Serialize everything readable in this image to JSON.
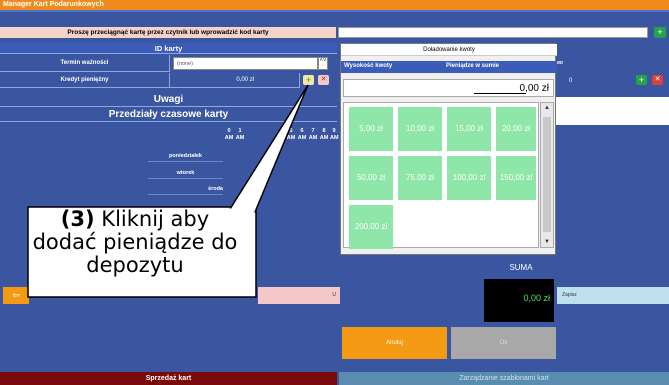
{
  "window": {
    "title": "Manager Kart Podarunkowych"
  },
  "prompt": {
    "text": "Proszę przeciągnąć kartę przez czytnik lub wprowadzić kod karty"
  },
  "card_form": {
    "id_header": "ID karty",
    "expiry_label": "Termin ważności",
    "expiry_value": "(none)",
    "credit_label": "Kredyt pieniężny",
    "credit_value": "0,00 zł",
    "right_value": "0",
    "right_hdr_partial": "wo"
  },
  "notes_header": "Uwagi",
  "time_ranges": {
    "header": "Przedziały czasowe karty",
    "hours": [
      "0",
      "1",
      "2",
      "",
      "5",
      "6",
      "7",
      "8",
      "9"
    ],
    "ampm": "AM",
    "days": [
      "poniedziałek",
      "wtorek",
      "środa"
    ]
  },
  "popup": {
    "title": "Doładowanie kwoty",
    "col_amount": "Wysokość kwoty",
    "col_money": "Pieniądze w sumie",
    "amount": "0,00 zł",
    "tiles": [
      "5,00 zł",
      "10,00 zł",
      "15,00 zł",
      "20,00 zł",
      "50,00 zł",
      "75,00 zł",
      "100,00 zł",
      "150,00 zł",
      "200,00 zł"
    ]
  },
  "summary": {
    "label": "SUMA",
    "value": "0,00 zł"
  },
  "buttons": {
    "cancel": "Anuluj",
    "ok": "Ok",
    "save": "Zapisz",
    "pink_partial": "U",
    "sale": "Sprzedaż kart",
    "templates": "Zarządzanie szablonami kart"
  },
  "callout": {
    "step": "(3)",
    "text": "Kliknij aby dodać pieniądze do depozytu"
  },
  "colors": {
    "titlebar": "#f08a1a",
    "background": "#3a56a0",
    "tile": "#8ee6a8",
    "cancel": "#f39a12",
    "sale": "#7a0a0a"
  }
}
